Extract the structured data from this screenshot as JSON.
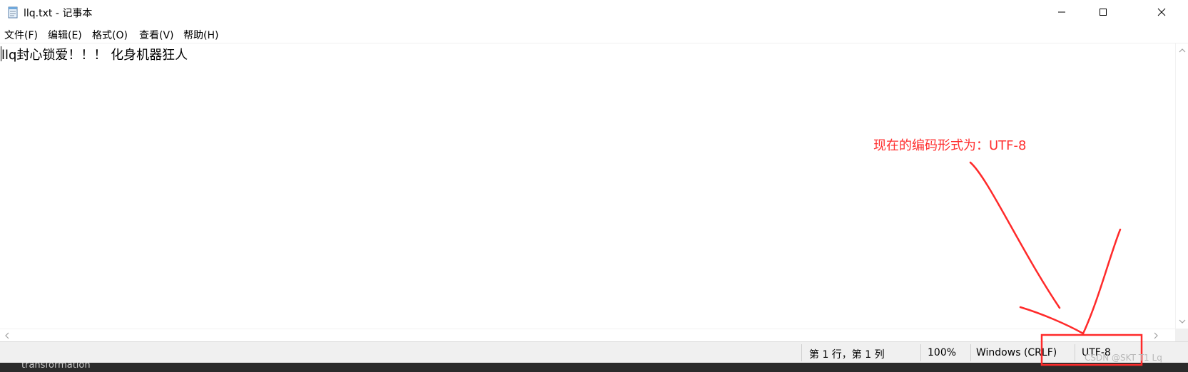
{
  "window": {
    "title": "llq.txt - 记事本",
    "icon": "notepad-icon",
    "controls": [
      "minimize-icon",
      "maximize-icon",
      "close-icon"
    ]
  },
  "menu": [
    {
      "label": "文件(F)"
    },
    {
      "label": "编辑(E)"
    },
    {
      "label": "格式(O)"
    },
    {
      "label": "查看(V)"
    },
    {
      "label": "帮助(H)"
    }
  ],
  "editor": {
    "content": "llq封心锁爱！！！ 化身机器狂人"
  },
  "statusbar": {
    "position": "第 1 行，第 1 列",
    "zoom": "100%",
    "line_ending": "Windows (CRLF)",
    "encoding": "UTF-8"
  },
  "annotation": {
    "text": "现在的编码形式为：UTF-8",
    "color": "#ff3030"
  },
  "background": {
    "taskbar_text": "transformation"
  },
  "watermark": "CSDN @SKT T1 Lq"
}
